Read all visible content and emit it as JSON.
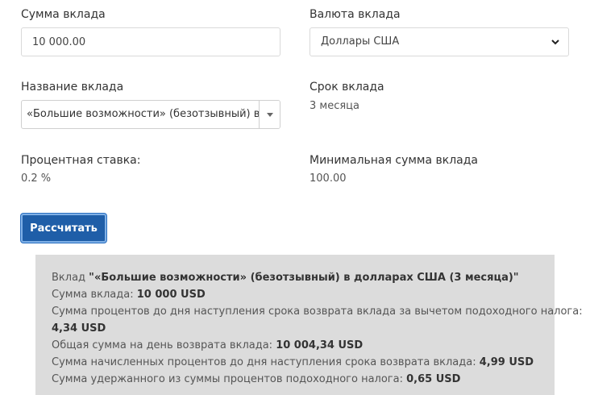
{
  "amount": {
    "label": "Сумма вклада",
    "value": "10 000.00"
  },
  "currency": {
    "label": "Валюта вклада",
    "selected": "Доллары США"
  },
  "deposit_name": {
    "label": "Название вклада",
    "selected": "«Большие возможности» (безотзывный) в долларах США"
  },
  "term": {
    "label": "Срок вклада",
    "value": "3 месяца"
  },
  "rate": {
    "label": "Процентная ставка:",
    "value": "0.2 %"
  },
  "min_amount": {
    "label": "Минимальная сумма вклада",
    "value": "100.00"
  },
  "calculate_button": "Рассчитать",
  "result": {
    "deposit_prefix": "Вклад ",
    "deposit_title": "\"«Большие возможности» (безотзывный) в долларах США (3 месяца)\"",
    "sum_label": "Сумма вклада: ",
    "sum_value": "10 000 USD",
    "interest_after_tax_label": "Сумма процентов до дня наступления срока возврата вклада за вычетом подоходного налога:",
    "interest_after_tax_value": "4,34 USD",
    "total_label": "Общая сумма на день возврата вклада: ",
    "total_value": "10 004,34 USD",
    "accrued_label": "Сумма начисленных процентов до дня наступления срока возврата вклада: ",
    "accrued_value": "4,99 USD",
    "tax_label": "Сумма удержанного из суммы процентов подоходного налога: ",
    "tax_value": "0,65 USD"
  },
  "colors": {
    "button_bg": "#1f5ea8",
    "result_bg": "#dcdcdc"
  }
}
